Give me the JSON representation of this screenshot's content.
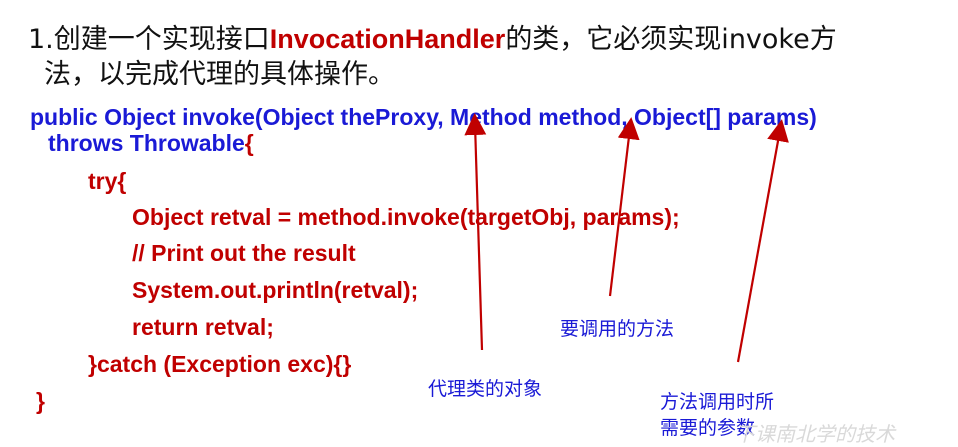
{
  "intro": {
    "line1_a": "1.创建一个实现接口",
    "line1_kw": "InvocationHandler",
    "line1_b": "的类，它必须实现invoke方",
    "line2": "法，以完成代理的具体操作。"
  },
  "code": {
    "sig_line1": "public Object invoke(Object theProxy, Method method, Object[] params)",
    "sig_line2_blue": "throws Throwable",
    "sig_line2_red": "{",
    "try_line": "try{",
    "line_retval": "Object retval = method.invoke(targetObj, params);",
    "line_comment": "// Print out the result",
    "line_print": "System.out.println(retval);",
    "line_return": "return retval;",
    "line_catch": "}catch (Exception exc){}",
    "line_close": "}"
  },
  "annotations": {
    "proxy": "代理类的对象",
    "method": "要调用的方法",
    "params_line1": "方法调用时所",
    "params_line2": "需要的参数"
  },
  "watermark": "下课南北学的技术",
  "colors": {
    "keyword_red": "#c00000",
    "code_blue": "#1a1ad6",
    "arrow": "#c00000"
  }
}
